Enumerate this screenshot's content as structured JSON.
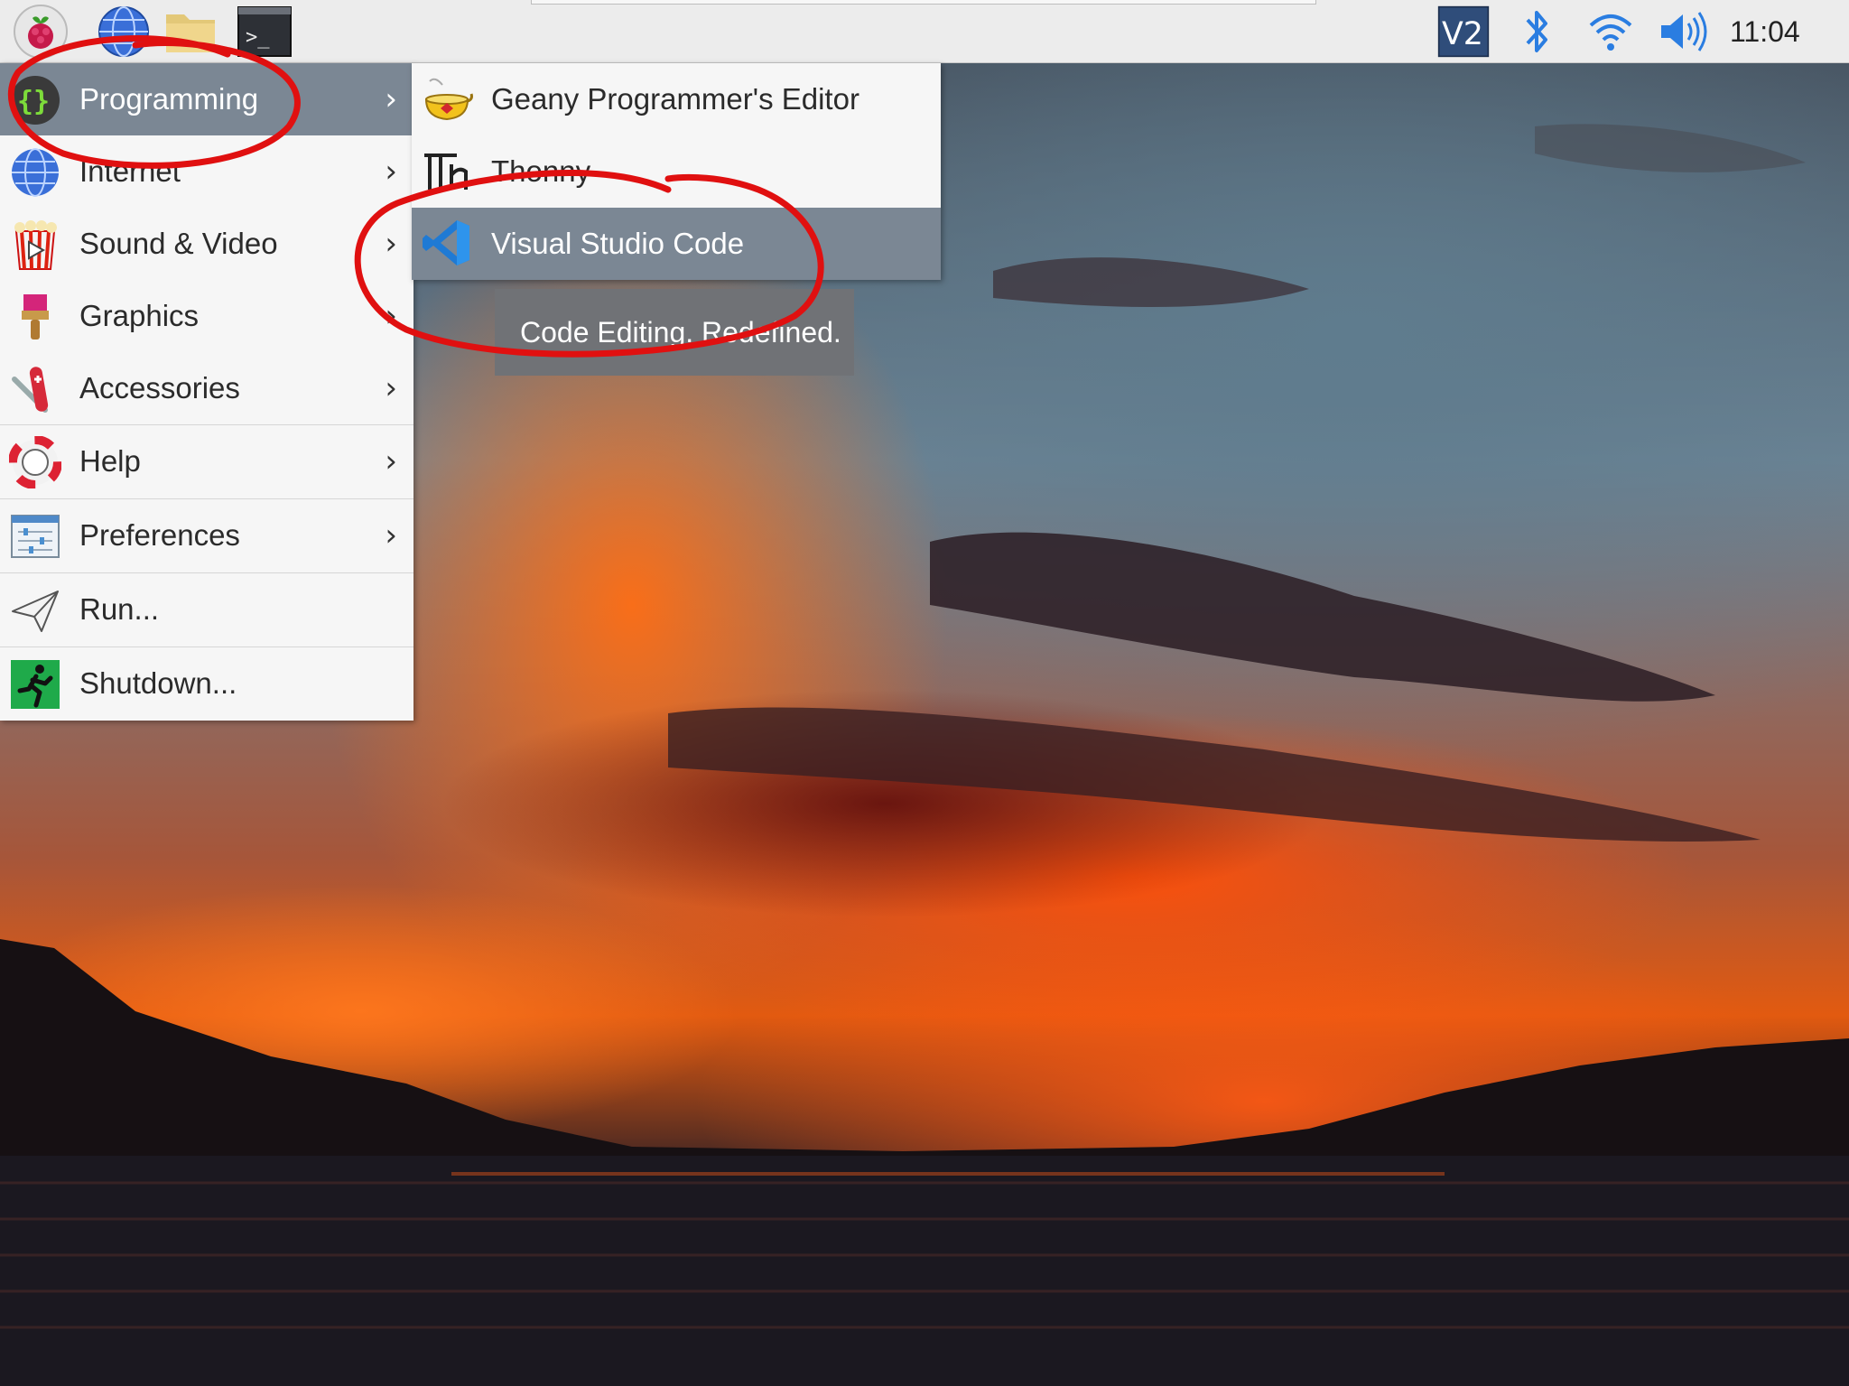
{
  "panel": {
    "launchers": [
      {
        "icon": "raspberry-icon"
      },
      {
        "icon": "web-browser-icon"
      },
      {
        "icon": "file-manager-icon"
      },
      {
        "icon": "terminal-icon",
        "label": ">_"
      }
    ],
    "tray": {
      "vnc_label": "V2",
      "bluetooth_icon": "bluetooth-icon",
      "wifi_icon": "wifi-icon",
      "volume_icon": "volume-icon",
      "clock": "11:04"
    }
  },
  "main_menu": {
    "items": [
      {
        "label": "Programming",
        "icon": "programming-icon",
        "submenu": true,
        "active": true
      },
      {
        "label": "Internet",
        "icon": "internet-icon",
        "submenu": true
      },
      {
        "label": "Sound & Video",
        "icon": "sound-video-icon",
        "submenu": true
      },
      {
        "label": "Graphics",
        "icon": "graphics-icon",
        "submenu": true
      },
      {
        "label": "Accessories",
        "icon": "accessories-icon",
        "submenu": true
      },
      {
        "label": "Help",
        "icon": "help-icon",
        "submenu": true
      },
      {
        "label": "Preferences",
        "icon": "preferences-icon",
        "submenu": true
      },
      {
        "label": "Run...",
        "icon": "run-icon",
        "submenu": false
      },
      {
        "label": "Shutdown...",
        "icon": "shutdown-icon",
        "submenu": false
      }
    ],
    "arrow": "›"
  },
  "programming_submenu": {
    "items": [
      {
        "label": "Geany Programmer's Editor",
        "icon": "geany-icon"
      },
      {
        "label": "Thonny",
        "icon": "thonny-icon"
      },
      {
        "label": "Visual Studio Code",
        "icon": "vscode-icon",
        "active": true
      }
    ]
  },
  "tooltip": {
    "text": "Code Editing. Redefined."
  },
  "colors": {
    "menu_bg": "#f6f6f6",
    "active_bg": "#7b8794",
    "annotation_red": "#e01010",
    "panel_bg": "#ececec",
    "tray_blue": "#2a7de1"
  }
}
